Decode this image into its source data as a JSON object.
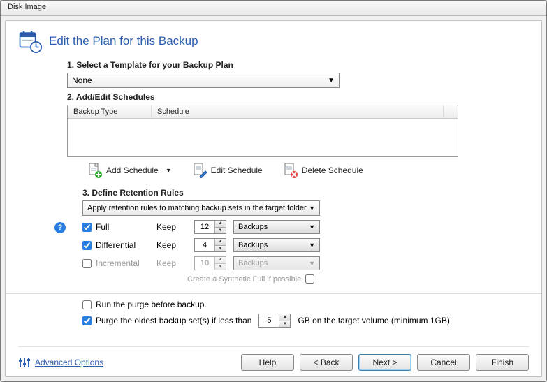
{
  "window": {
    "title": "Disk Image"
  },
  "page": {
    "title": "Edit the Plan for this Backup"
  },
  "step1": {
    "label": "1. Select a Template for your Backup Plan",
    "selected": "None"
  },
  "step2": {
    "label": "2. Add/Edit Schedules",
    "columns": {
      "type": "Backup Type",
      "schedule": "Schedule"
    },
    "rows": [],
    "buttons": {
      "add": "Add Schedule",
      "edit": "Edit Schedule",
      "del": "Delete Schedule"
    }
  },
  "step3": {
    "label": "3. Define Retention Rules",
    "scope": "Apply retention rules to matching backup sets in the target folder",
    "rows": {
      "full": {
        "checked": true,
        "label": "Full",
        "keep": "Keep",
        "count": "12",
        "unit": "Backups"
      },
      "differential": {
        "checked": true,
        "label": "Differential",
        "keep": "Keep",
        "count": "4",
        "unit": "Backups"
      },
      "incremental": {
        "checked": false,
        "label": "Incremental",
        "keep": "Keep",
        "count": "10",
        "unit": "Backups"
      }
    },
    "synthetic": {
      "label": "Create a Synthetic Full if possible",
      "checked": false
    }
  },
  "purge": {
    "before": {
      "checked": false,
      "label": "Run the purge before backup."
    },
    "oldest": {
      "checked": true,
      "label_before": "Purge the oldest backup set(s) if less than",
      "value": "5",
      "label_after": "GB on the target volume (minimum 1GB)"
    }
  },
  "footer": {
    "advanced": "Advanced Options",
    "buttons": {
      "help": "Help",
      "back": "< Back",
      "next": "Next >",
      "cancel": "Cancel",
      "finish": "Finish"
    }
  }
}
